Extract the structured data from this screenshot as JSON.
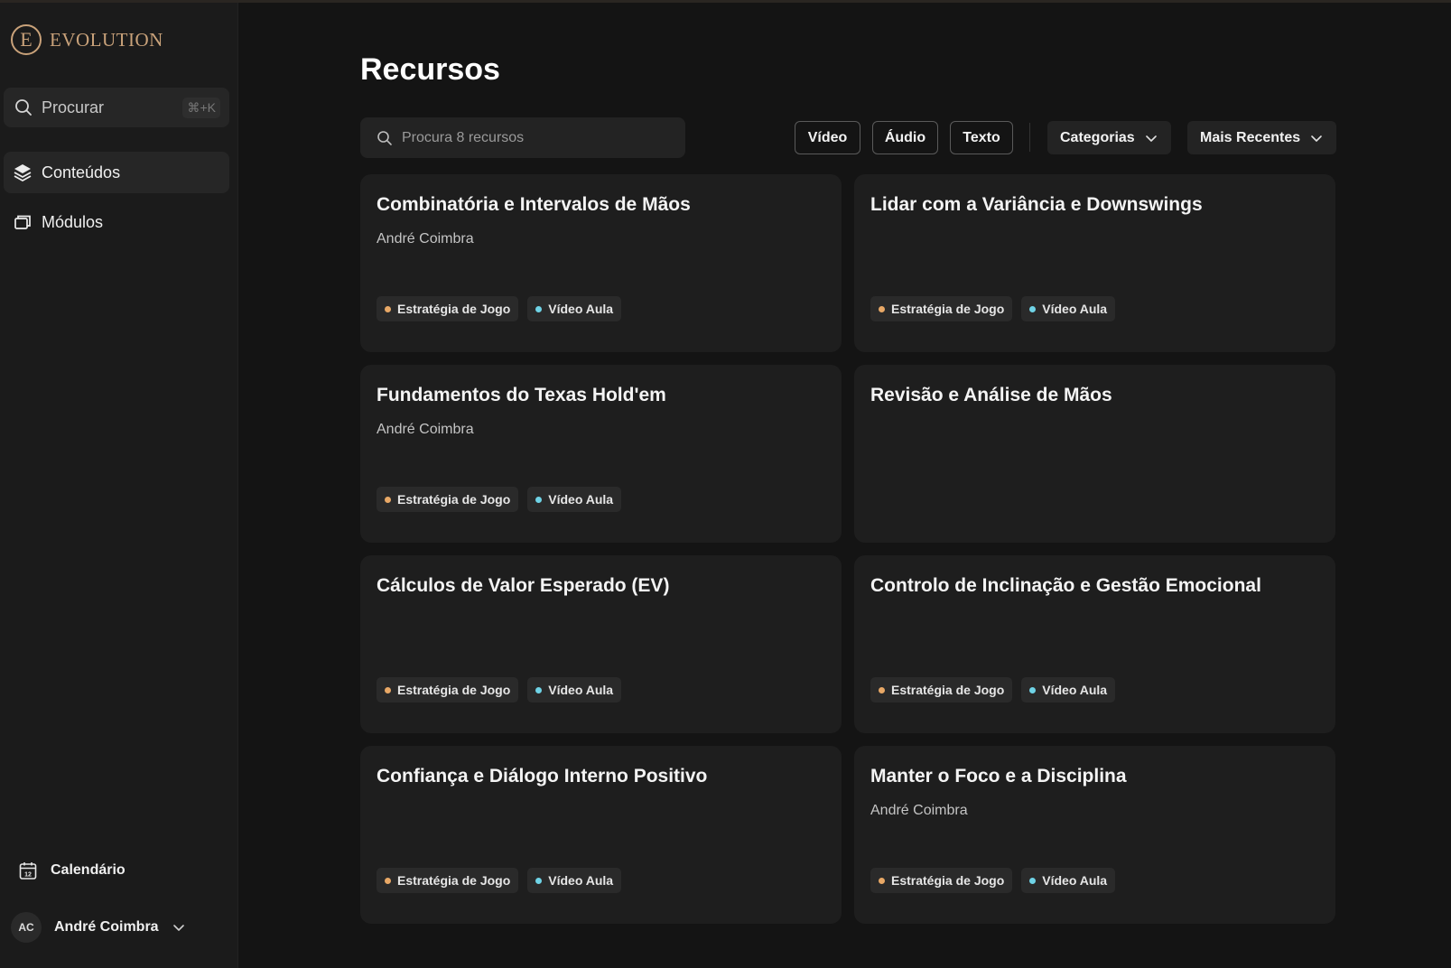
{
  "brand": {
    "mark": "E",
    "name": "EVOLUTION"
  },
  "sidebar": {
    "search": {
      "label": "Procurar",
      "shortcut": "⌘+K"
    },
    "items": [
      {
        "label": "Conteúdos",
        "icon": "layers-icon",
        "active": true
      },
      {
        "label": "Módulos",
        "icon": "window-stack-icon",
        "active": false
      }
    ],
    "calendar_label": "Calendário",
    "calendar_day": "12",
    "user": {
      "initials": "AC",
      "name": "André Coimbra"
    }
  },
  "main": {
    "title": "Recursos",
    "search_placeholder": "Procura 8 recursos",
    "filters": [
      "Vídeo",
      "Áudio",
      "Texto"
    ],
    "categories_label": "Categorias",
    "sort_label": "Mais Recentes"
  },
  "colors": {
    "tag_strategy": "#e8a866",
    "tag_video": "#6fd3e6",
    "accent": "#c9a27a"
  },
  "cards": [
    {
      "title": "Combinatória e Intervalos de Mãos",
      "author": "André Coimbra",
      "tags": [
        "Estratégia de Jogo",
        "Vídeo Aula"
      ]
    },
    {
      "title": "Lidar com a Variância e Downswings",
      "author": "",
      "tags": [
        "Estratégia de Jogo",
        "Vídeo Aula"
      ]
    },
    {
      "title": "Fundamentos do Texas Hold'em",
      "author": "André Coimbra",
      "tags": [
        "Estratégia de Jogo",
        "Vídeo Aula"
      ]
    },
    {
      "title": "Revisão e Análise de Mãos",
      "author": "",
      "tags": []
    },
    {
      "title": "Cálculos de Valor Esperado (EV)",
      "author": "",
      "tags": [
        "Estratégia de Jogo",
        "Vídeo Aula"
      ]
    },
    {
      "title": "Controlo de Inclinação e Gestão Emocional",
      "author": "",
      "tags": [
        "Estratégia de Jogo",
        "Vídeo Aula"
      ]
    },
    {
      "title": "Confiança e Diálogo Interno Positivo",
      "author": "",
      "tags": [
        "Estratégia de Jogo",
        "Vídeo Aula"
      ]
    },
    {
      "title": "Manter o Foco e a Disciplina",
      "author": "André Coimbra",
      "tags": [
        "Estratégia de Jogo",
        "Vídeo Aula"
      ]
    }
  ]
}
